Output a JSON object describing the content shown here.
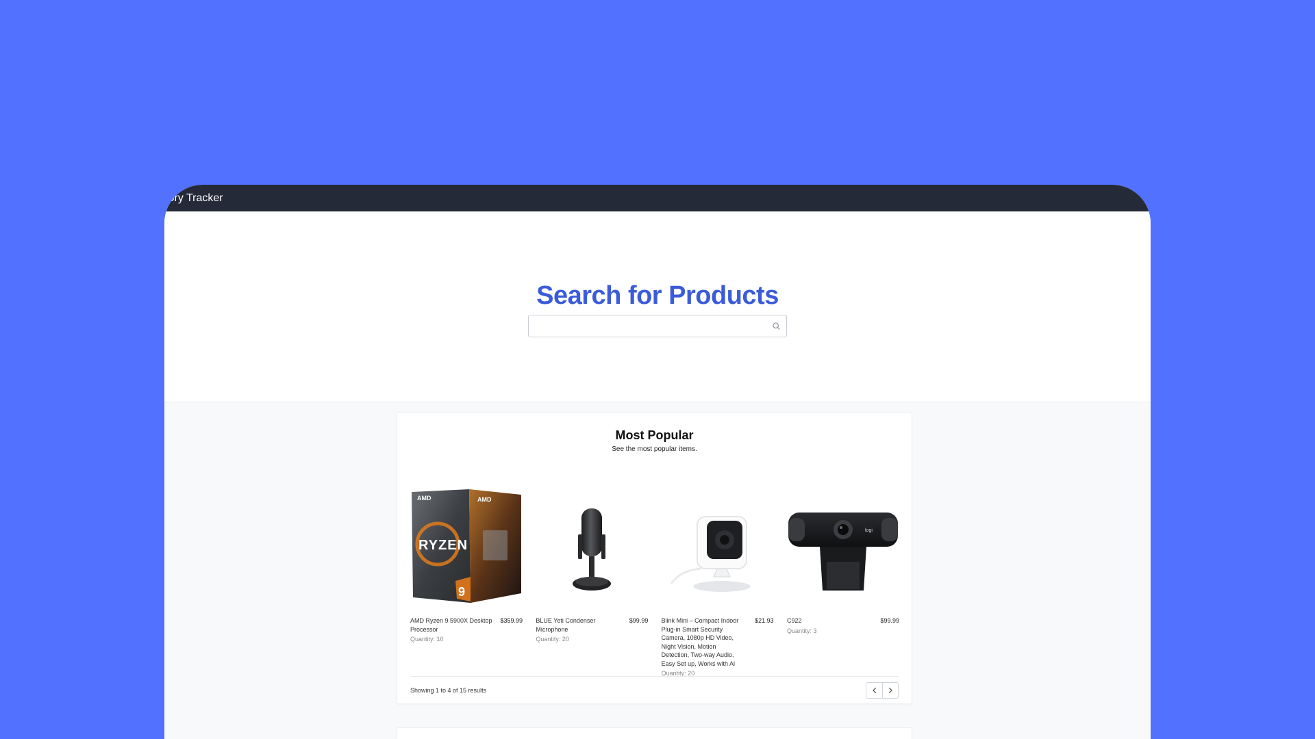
{
  "window": {
    "title": "Inventory Tracker"
  },
  "hero": {
    "heading": "Search for Products",
    "search_placeholder": ""
  },
  "popular": {
    "title": "Most Popular",
    "subtitle": "See the most popular items.",
    "quantity_label": "Quantity:",
    "products": [
      {
        "name": "AMD Ryzen 9 5900X Desktop Processor",
        "price": "$359.99",
        "quantity": "10"
      },
      {
        "name": "BLUE Yeti Condenser Microphone",
        "price": "$99.99",
        "quantity": "20"
      },
      {
        "name": "Blink Mini – Compact Indoor Plug-in Smart Security Camera, 1080p HD Video, Night Vision, Motion Detection, Two-way Audio, Easy Set up, Works with Al",
        "price": "$21.93",
        "quantity": "20"
      },
      {
        "name": "C922",
        "price": "$99.99",
        "quantity": "3"
      }
    ],
    "results_text": "Showing 1 to 4 of 15 results",
    "pager": {
      "prev_icon": "chevron-left-icon",
      "next_icon": "chevron-right-icon"
    }
  },
  "colors": {
    "background": "#5271ff",
    "titlebar": "#242a38",
    "heading": "#3b5bdb"
  },
  "product_images": {
    "ryzen_brand": "AMD",
    "ryzen_box_text": "RYZEN",
    "ryzen_tier": "9",
    "webcam_brand": "logi"
  }
}
